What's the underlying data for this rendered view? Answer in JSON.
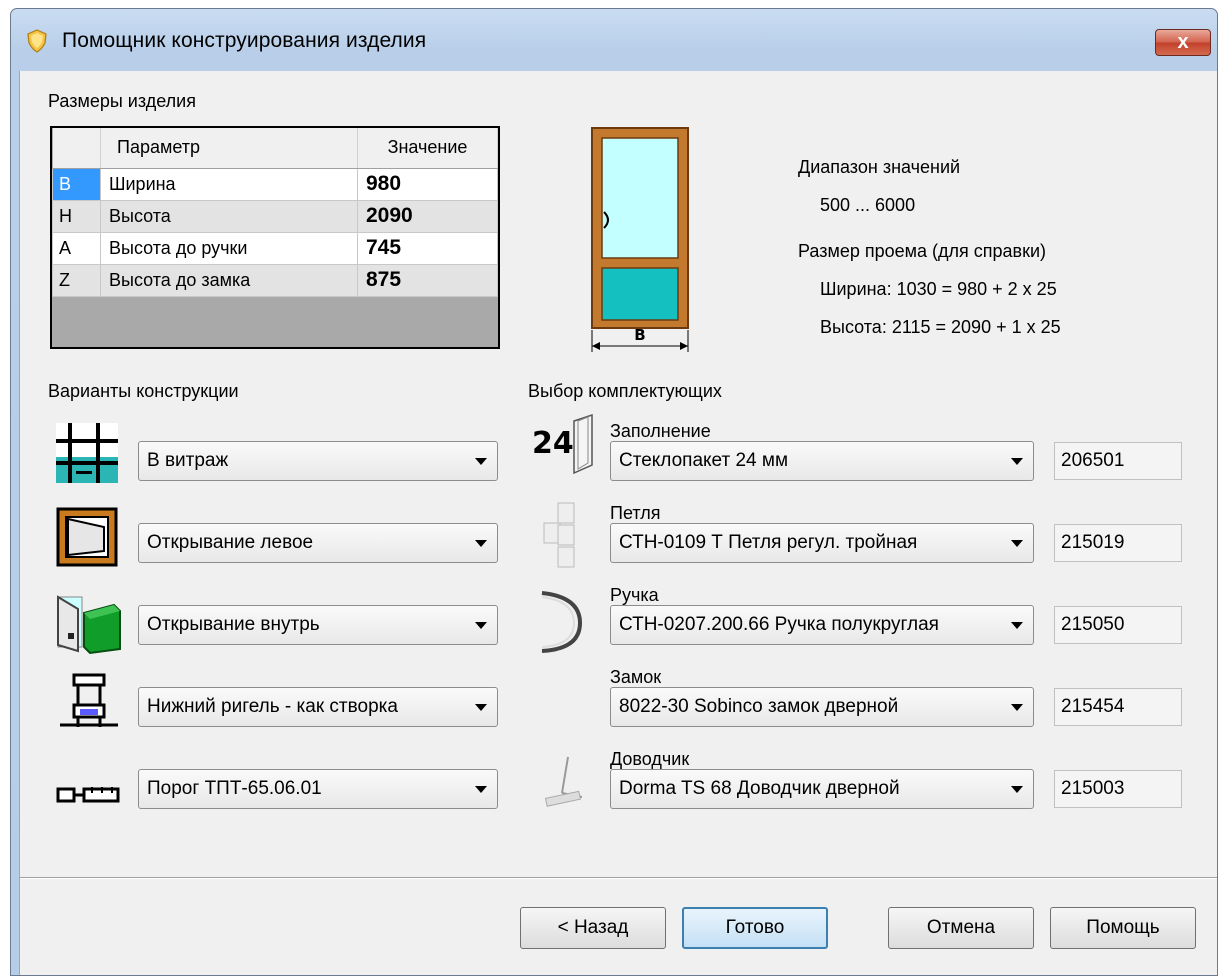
{
  "window": {
    "title": "Помощник конструирования изделия",
    "close_label": "x"
  },
  "size_section": {
    "label": "Размеры изделия",
    "columns": [
      "Параметр",
      "Значение"
    ],
    "rows": [
      {
        "key": "B",
        "name": "Ширина",
        "value": "980"
      },
      {
        "key": "H",
        "name": "Высота",
        "value": "2090"
      },
      {
        "key": "A",
        "name": "Высота до ручки",
        "value": "745"
      },
      {
        "key": "Z",
        "name": "Высота до замка",
        "value": "875"
      }
    ]
  },
  "drawing": {
    "dimension_label": "B"
  },
  "info": {
    "range_label": "Диапазон значений",
    "range_value": "500 ... 6000",
    "opening_label": "Размер проема (для справки)",
    "opening_width": "Ширина: 1030 = 980 + 2 x 25",
    "opening_height": "Высота: 2115 = 2090 + 1 x 25"
  },
  "construction": {
    "label": "Варианты конструкции",
    "options": [
      {
        "value": "В витраж",
        "icon": "mullion-frame-icon"
      },
      {
        "value": "Открывание левое",
        "icon": "left-opening-icon"
      },
      {
        "value": "Открывание внутрь",
        "icon": "inward-opening-icon"
      },
      {
        "value": "Нижний ригель - как створка",
        "icon": "bottom-rail-icon"
      },
      {
        "value": "Порог ТПТ-65.06.01",
        "icon": "threshold-icon"
      }
    ]
  },
  "components": {
    "label": "Выбор комплектующих",
    "items": [
      {
        "label": "Заполнение",
        "value": "Стеклопакет 24 мм",
        "code": "206501",
        "icon": "glass-unit-icon",
        "icon_text": "24"
      },
      {
        "label": "Петля",
        "value": "СТН-0109 Т Петля регул. тройная",
        "code": "215019",
        "icon": "hinge-icon"
      },
      {
        "label": "Ручка",
        "value": "СТН-0207.200.66 Ручка полукруглая",
        "code": "215050",
        "icon": "handle-icon"
      },
      {
        "label": "Замок",
        "value": "8022-30 Sobinco замок дверной",
        "code": "215454",
        "icon": "lock-icon"
      },
      {
        "label": "Доводчик",
        "value": "Dorma TS 68 Доводчик дверной",
        "code": "215003",
        "icon": "door-closer-icon"
      }
    ]
  },
  "buttons": {
    "back": "< Назад",
    "finish": "Готово",
    "cancel": "Отмена",
    "help": "Помощь"
  }
}
